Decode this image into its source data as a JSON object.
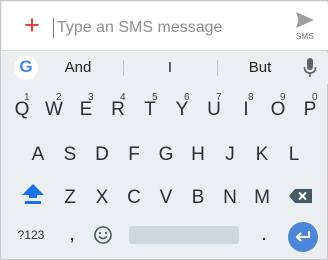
{
  "compose": {
    "placeholder": "Type an SMS message",
    "plus_symbol": "+",
    "send_label": "SMS",
    "accent_color": "#e53935"
  },
  "suggestions": {
    "google_letter": "G",
    "words": [
      "And",
      "I",
      "But"
    ]
  },
  "keyboard": {
    "row1": [
      {
        "ch": "Q",
        "num": "1"
      },
      {
        "ch": "W",
        "num": "2"
      },
      {
        "ch": "E",
        "num": "3"
      },
      {
        "ch": "R",
        "num": "4"
      },
      {
        "ch": "T",
        "num": "5"
      },
      {
        "ch": "Y",
        "num": "6"
      },
      {
        "ch": "U",
        "num": "7"
      },
      {
        "ch": "I",
        "num": "8"
      },
      {
        "ch": "O",
        "num": "9"
      },
      {
        "ch": "P",
        "num": "0"
      }
    ],
    "row2": [
      "A",
      "S",
      "D",
      "F",
      "G",
      "H",
      "J",
      "K",
      "L"
    ],
    "row3": [
      "Z",
      "X",
      "C",
      "V",
      "B",
      "N",
      "M"
    ],
    "bottom": {
      "symbols_label": "?123",
      "comma": ",",
      "period": "."
    },
    "enter_color": "#4b86d8",
    "shift_color": "#1a73e8"
  }
}
